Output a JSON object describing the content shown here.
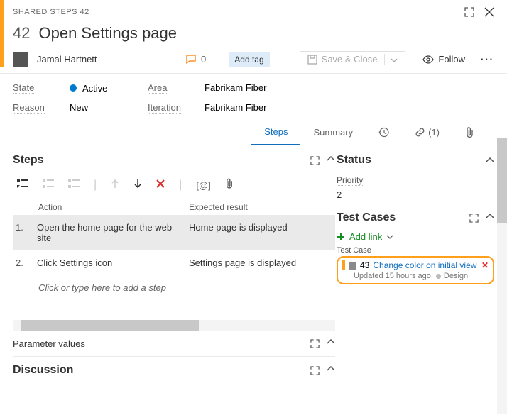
{
  "header": {
    "type_label": "SHARED STEPS 42",
    "id": "42",
    "title": "Open Settings page",
    "assignee": "Jamal Hartnett",
    "discussion_count": "0",
    "add_tag": "Add tag",
    "save_close": "Save & Close",
    "follow": "Follow"
  },
  "fields": {
    "state_label": "State",
    "state_value": "Active",
    "reason_label": "Reason",
    "reason_value": "New",
    "area_label": "Area",
    "area_value": "Fabrikam Fiber",
    "iteration_label": "Iteration",
    "iteration_value": "Fabrikam Fiber"
  },
  "tabs": {
    "steps": "Steps",
    "summary": "Summary",
    "links_count": "(1)"
  },
  "steps_section": {
    "title": "Steps",
    "col_action": "Action",
    "col_expected": "Expected result",
    "rows": [
      {
        "num": "1.",
        "action": "Open the home page for the web site",
        "expected": "Home page is displayed"
      },
      {
        "num": "2.",
        "action": "Click Settings icon",
        "expected": "Settings page is displayed"
      }
    ],
    "placeholder": "Click or type here to add a step",
    "param_values": "Parameter values",
    "discussion": "Discussion"
  },
  "status_section": {
    "title": "Status",
    "priority_label": "Priority",
    "priority_value": "2",
    "test_cases_title": "Test Cases",
    "add_link": "Add link",
    "tc_label": "Test Case",
    "tc_id": "43",
    "tc_title": "Change color on initial view",
    "tc_updated": "Updated 15 hours ago,",
    "tc_state": "Design"
  }
}
